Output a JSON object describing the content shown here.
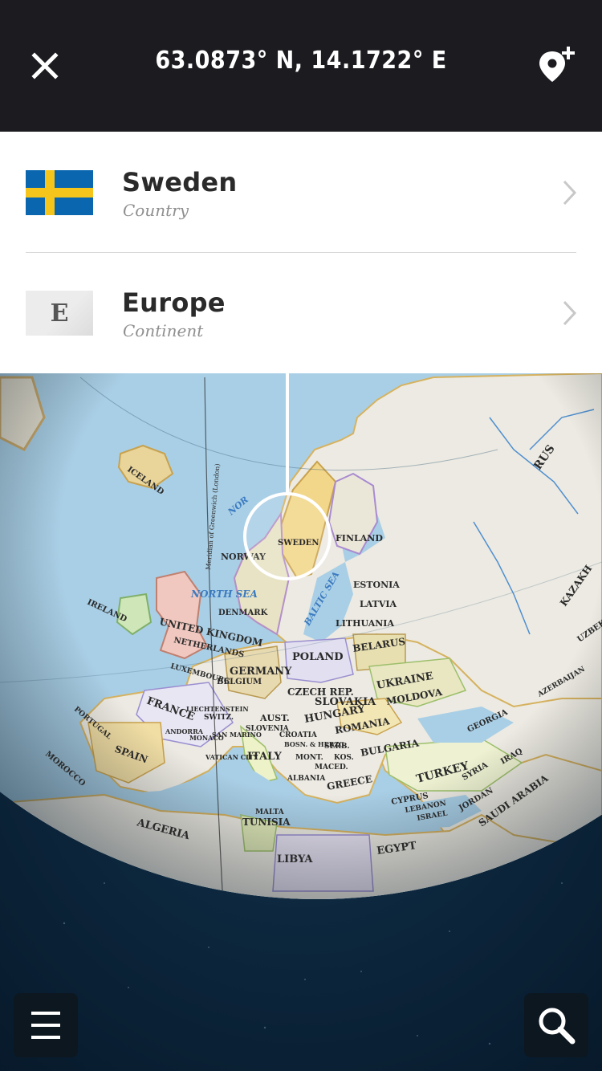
{
  "header": {
    "coordinates": "63.0873° N, 14.1722° E",
    "close_icon": "close-icon",
    "add_pin_icon": "add-location-pin-icon"
  },
  "results": [
    {
      "title": "Sweden",
      "subtitle": "Country",
      "icon": "sweden-flag-icon"
    },
    {
      "title": "Europe",
      "subtitle": "Continent",
      "icon_letter": "E"
    }
  ],
  "map": {
    "marker_label": "SWEDEN",
    "labels": [
      "ICELAND",
      "NORWAY",
      "FINLAND",
      "ESTONIA",
      "LATVIA",
      "LITHUANIA",
      "NORTH SEA",
      "BALTIC SEA",
      "IRELAND",
      "UNITED KINGDOM",
      "NETHERLANDS",
      "DENMARK",
      "POLAND",
      "BELARUS",
      "GERMANY",
      "BELGIUM",
      "LUXEMBOURG",
      "CZECH REP.",
      "SLOVAKIA",
      "UKRAINE",
      "MOLDOVA",
      "FRANCE",
      "SWITZ.",
      "AUST.",
      "HUNGARY",
      "ROMANIA",
      "SLOVENIA",
      "CROATIA",
      "SPAIN",
      "PORTUGAL",
      "ITALY",
      "BULGARIA",
      "GREECE",
      "TURKEY",
      "MOROCCO",
      "ALGERIA",
      "TUNISIA",
      "LIBYA",
      "EGYPT",
      "GEORGIA",
      "SYRIA",
      "IRAQ",
      "CYPRUS",
      "LEBANON",
      "ISRAEL",
      "JORDAN",
      "SAUDI ARABIA",
      "KAZAKH",
      "UZBEK",
      "RUS",
      "AZERBAIJAN",
      "ALBANIA",
      "MACED.",
      "KOS.",
      "SERB.",
      "MONT.",
      "BOSN. & HERZG.",
      "SAN MARINO",
      "MONACO",
      "ANDORRA",
      "VATICAN CITY",
      "LIECHTENSTEIN",
      "MALTA",
      "Meridian of Greenwich (London)",
      "NOR"
    ]
  },
  "buttons": {
    "menu_icon": "hamburger-menu-icon",
    "search_icon": "search-icon"
  },
  "colors": {
    "header_bg": "#1b1b20",
    "space_bg": "#0b2236",
    "sea": "#a9cfe6",
    "land": "#eceae2"
  }
}
